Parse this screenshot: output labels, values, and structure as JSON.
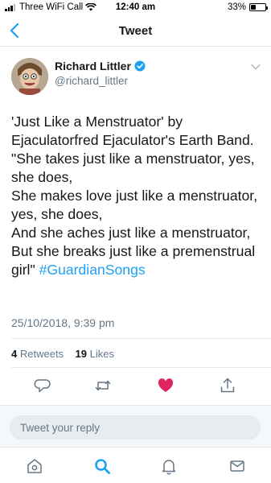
{
  "status_bar": {
    "carrier": "Three WiFi Call",
    "time": "12:40 am",
    "battery": "33%",
    "battery_level": 0.33
  },
  "nav": {
    "title": "Tweet",
    "back_icon": "chevron-left-icon"
  },
  "tweet": {
    "author_name": "Richard Littler",
    "handle": "@richard_littler",
    "verified": true,
    "text": "'Just Like a Menstruator' by\nEjaculatorfred Ejaculator's Earth Band.\n\"She takes just like a menstruator, yes,\nshe does,\nShe makes love just like a menstruator,\nyes, she does,\nAnd she aches just like a menstruator,\nBut she breaks just like a premenstrual\ngirl\" ",
    "hashtag": "#GuardianSongs",
    "timestamp": "25/10/2018, 9:39 pm",
    "retweets_count": "4",
    "retweets_label": "Retweets",
    "likes_count": "19",
    "likes_label": "Likes"
  },
  "actions": [
    "reply-icon",
    "retweet-icon",
    "like-icon",
    "share-icon"
  ],
  "reply": {
    "placeholder": "Tweet your reply"
  },
  "tab_bar": [
    "home-icon",
    "search-icon",
    "notifications-icon",
    "messages-icon"
  ],
  "colors": {
    "accent": "#1da1f2",
    "like": "#e0245e",
    "muted": "#657786",
    "border": "#e1e8ed"
  }
}
